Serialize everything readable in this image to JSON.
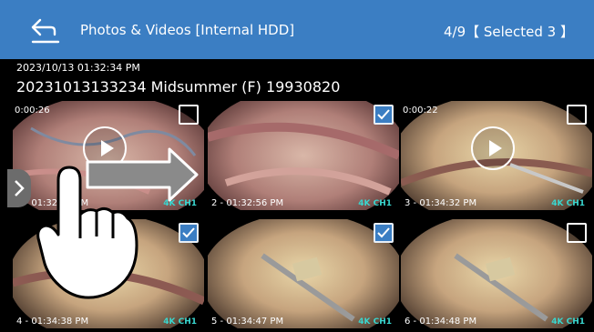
{
  "header": {
    "title": "Photos & Videos  [Internal HDD]",
    "counter": "4/9【 Selected 3 】"
  },
  "meta": {
    "datetime": "2023/10/13 01:32:34 PM",
    "name": "20231013133234 Midsummer (F) 19930820"
  },
  "tiles": [
    {
      "duration": "0:00:26",
      "caption": "1 - 01:32:34 PM",
      "badge": "4K CH1",
      "selected": false,
      "is_video": true
    },
    {
      "duration": "",
      "caption": "2 - 01:32:56 PM",
      "badge": "4K CH1",
      "selected": true,
      "is_video": false
    },
    {
      "duration": "0:00:22",
      "caption": "3 - 01:34:32 PM",
      "badge": "4K CH1",
      "selected": false,
      "is_video": true
    },
    {
      "duration": "",
      "caption": "4 - 01:34:38 PM",
      "badge": "4K CH1",
      "selected": true,
      "is_video": false
    },
    {
      "duration": "",
      "caption": "5 - 01:34:47 PM",
      "badge": "4K CH1",
      "selected": true,
      "is_video": false
    },
    {
      "duration": "",
      "caption": "6 - 01:34:48 PM",
      "badge": "4K CH1",
      "selected": false,
      "is_video": false
    }
  ],
  "icons": {
    "back": "back-arrow-icon",
    "checkbox": "checkbox-icon",
    "play": "play-icon",
    "side": "chevron-left-icon",
    "gesture": "swipe-hand-icon"
  },
  "colors": {
    "header": "#3b7ec3",
    "badge": "#39d6cf",
    "check_on": "#3b7ec3"
  }
}
